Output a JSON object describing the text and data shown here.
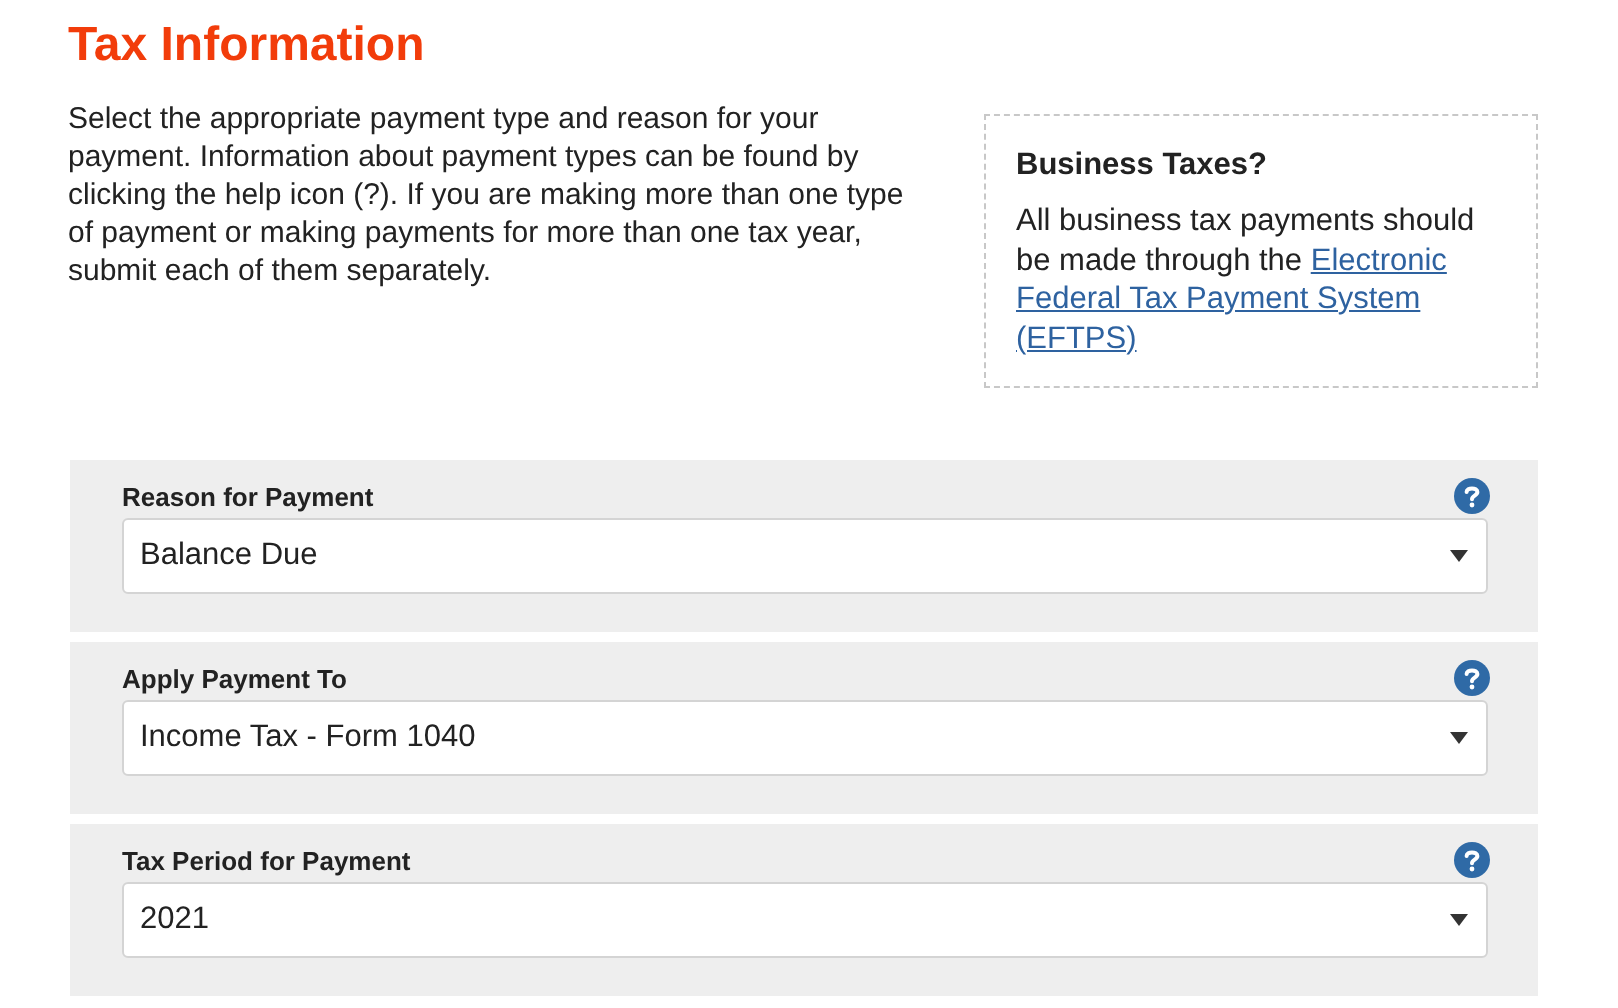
{
  "title": "Tax Information",
  "intro": "Select the appropriate payment type and reason for your payment. Information about payment types can be found by clicking the help icon (?). If you are making more than one type of payment or making payments for more than one tax year, submit each of them separately.",
  "aside": {
    "heading": "Business Taxes?",
    "text": "All business tax payments should be made through the ",
    "link_lines": [
      "Electronic",
      "Federal Tax Payment System",
      "(EFTPS)"
    ]
  },
  "fields": [
    {
      "label": "Reason for Payment",
      "value": "Balance Due"
    },
    {
      "label": "Apply Payment To",
      "value": "Income Tax - Form 1040"
    },
    {
      "label": "Tax Period for Payment",
      "value": "2021"
    }
  ]
}
